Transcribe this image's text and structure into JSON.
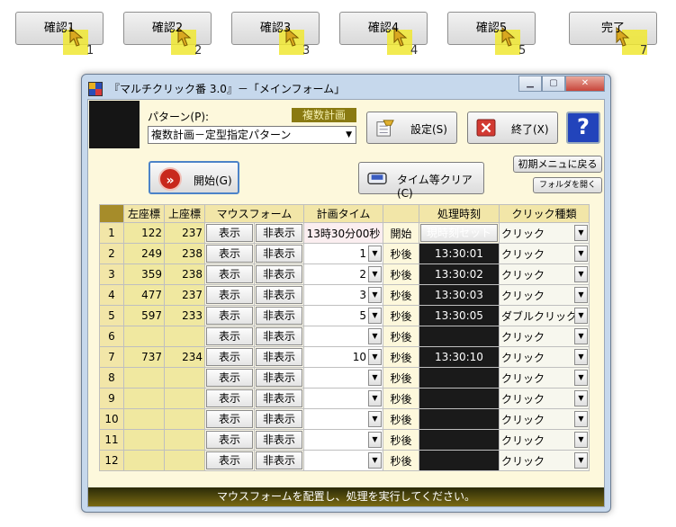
{
  "confirm_buttons": [
    {
      "label": "確認1",
      "num": "1"
    },
    {
      "label": "確認2",
      "num": "2"
    },
    {
      "label": "確認3",
      "num": "3"
    },
    {
      "label": "確認4",
      "num": "4"
    },
    {
      "label": "確認5",
      "num": "5"
    },
    {
      "label": "完了",
      "num": "7"
    }
  ],
  "window": {
    "title": "『マルチクリック番 3.0』－「メインフォーム」",
    "icon": "app-grid-icon"
  },
  "pattern": {
    "label": "パターン(P):",
    "badge": "複数計画",
    "selected": "複数計画－定型指定パターン"
  },
  "buttons": {
    "settings": "設定(S)",
    "exit": "終了(X)",
    "help": "?",
    "start": "開始(G)",
    "start_icon": "»",
    "clear": "タイム等クリア(C)",
    "initial_menu": "初期メニュに戻る",
    "open_folder": "フォルダを開く"
  },
  "grid": {
    "headers": {
      "x": "左座標",
      "y": "上座標",
      "mouse_form": "マウスフォーム",
      "plan_time": "計画タイム",
      "process_time": "処理時刻",
      "click_type": "クリック種類"
    },
    "show_label": "表示",
    "hide_label": "非表示",
    "rows": [
      {
        "n": "1",
        "x": "122",
        "y": "237",
        "time": "13時30分00秒",
        "unit": "開始",
        "ptime": "現時刻セット",
        "click": "クリック"
      },
      {
        "n": "2",
        "x": "249",
        "y": "238",
        "time": "1",
        "unit": "秒後",
        "ptime": "13:30:01",
        "click": "クリック"
      },
      {
        "n": "3",
        "x": "359",
        "y": "238",
        "time": "2",
        "unit": "秒後",
        "ptime": "13:30:02",
        "click": "クリック"
      },
      {
        "n": "4",
        "x": "477",
        "y": "237",
        "time": "3",
        "unit": "秒後",
        "ptime": "13:30:03",
        "click": "クリック"
      },
      {
        "n": "5",
        "x": "597",
        "y": "233",
        "time": "5",
        "unit": "秒後",
        "ptime": "13:30:05",
        "click": "ダブルクリック"
      },
      {
        "n": "6",
        "x": "",
        "y": "",
        "time": "",
        "unit": "秒後",
        "ptime": "",
        "click": "クリック"
      },
      {
        "n": "7",
        "x": "737",
        "y": "234",
        "time": "10",
        "unit": "秒後",
        "ptime": "13:30:10",
        "click": "クリック"
      },
      {
        "n": "8",
        "x": "",
        "y": "",
        "time": "",
        "unit": "秒後",
        "ptime": "",
        "click": "クリック"
      },
      {
        "n": "9",
        "x": "",
        "y": "",
        "time": "",
        "unit": "秒後",
        "ptime": "",
        "click": "クリック"
      },
      {
        "n": "10",
        "x": "",
        "y": "",
        "time": "",
        "unit": "秒後",
        "ptime": "",
        "click": "クリック"
      },
      {
        "n": "11",
        "x": "",
        "y": "",
        "time": "",
        "unit": "秒後",
        "ptime": "",
        "click": "クリック"
      },
      {
        "n": "12",
        "x": "",
        "y": "",
        "time": "",
        "unit": "秒後",
        "ptime": "",
        "click": "クリック"
      }
    ]
  },
  "status": "マウスフォームを配置し、処理を実行してください。",
  "colors": {
    "marker": "#f0e832",
    "client_bg": "#fdf8dc",
    "status_bar": "#5a4e10",
    "help_blue": "#2244bb"
  }
}
